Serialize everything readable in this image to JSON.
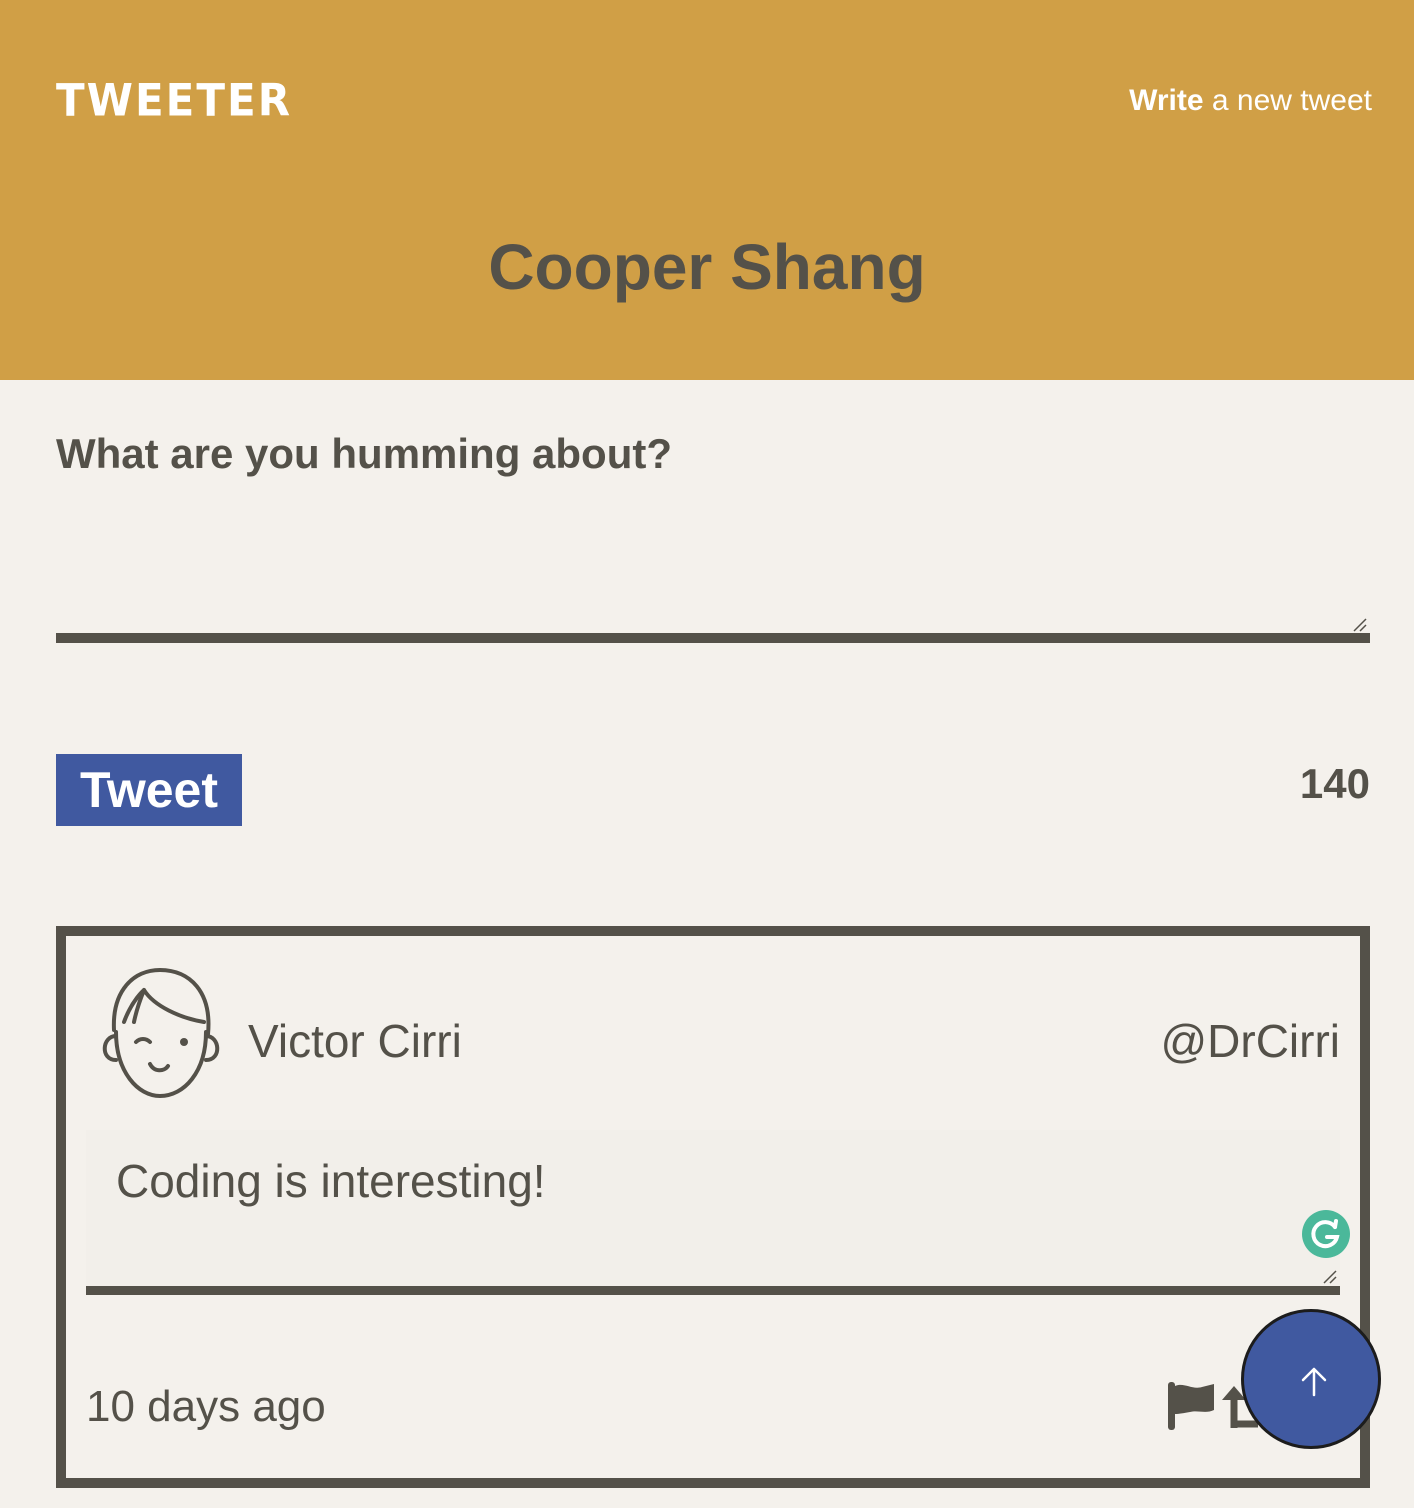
{
  "header": {
    "logo": "TWEETER",
    "compose_bold": "Write",
    "compose_rest": " a new tweet",
    "profile_name": "Cooper Shang"
  },
  "compose": {
    "label": "What are you humming about?",
    "textarea_value": "",
    "tweet_button_label": "Tweet",
    "char_counter": "140"
  },
  "tweets": [
    {
      "author_name": "Victor Cirri",
      "author_handle": "@DrCirri",
      "text": "Coding is interesting!",
      "timestamp": "10 days ago",
      "action_icons": [
        "flag-icon",
        "retweet-icon"
      ]
    }
  ],
  "colors": {
    "header_bg": "#d09f46",
    "page_bg": "#f4f1ec",
    "text": "#545149",
    "accent_blue": "#4059a0",
    "grammarly_green": "#4bb89a"
  },
  "floating": {
    "scroll_top_icon": "arrow-up-icon"
  }
}
